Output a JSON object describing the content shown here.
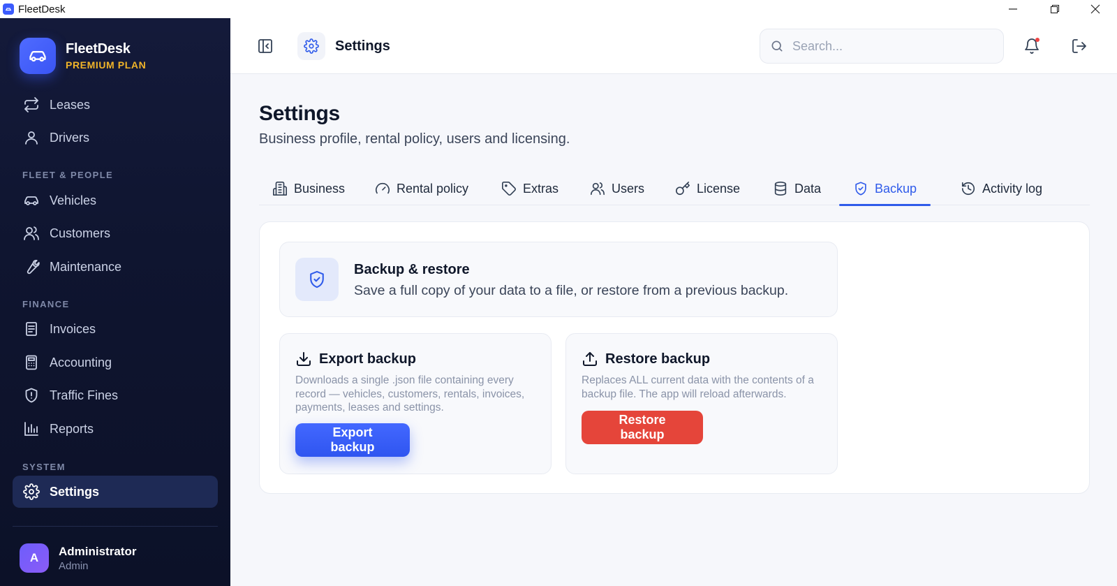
{
  "window": {
    "title": "FleetDesk"
  },
  "brand": {
    "name": "FleetDesk",
    "plan": "PREMIUM PLAN"
  },
  "sidebar": {
    "top_items": [
      {
        "label": "Leases",
        "icon": "repeat-icon"
      },
      {
        "label": "Drivers",
        "icon": "user-icon"
      }
    ],
    "sections": [
      {
        "title": "FLEET & PEOPLE",
        "items": [
          {
            "label": "Vehicles",
            "icon": "car-icon"
          },
          {
            "label": "Customers",
            "icon": "users-icon"
          },
          {
            "label": "Maintenance",
            "icon": "wrench-icon"
          }
        ]
      },
      {
        "title": "FINANCE",
        "items": [
          {
            "label": "Invoices",
            "icon": "receipt-icon"
          },
          {
            "label": "Accounting",
            "icon": "calculator-icon"
          },
          {
            "label": "Traffic Fines",
            "icon": "shield-alert-icon"
          },
          {
            "label": "Reports",
            "icon": "bar-chart-icon"
          }
        ]
      },
      {
        "title": "SYSTEM",
        "items": [
          {
            "label": "Settings",
            "icon": "gear-icon",
            "active": true
          }
        ]
      }
    ]
  },
  "user": {
    "initial": "A",
    "name": "Administrator",
    "role": "Admin"
  },
  "header": {
    "title": "Settings",
    "search_placeholder": "Search...",
    "notification_dot_color": "#ef4444"
  },
  "page": {
    "title": "Settings",
    "subtitle": "Business profile, rental policy, users and licensing."
  },
  "tabs": [
    {
      "label": "Business",
      "icon": "building-icon"
    },
    {
      "label": "Rental policy",
      "icon": "gauge-icon"
    },
    {
      "label": "Extras",
      "icon": "tag-icon"
    },
    {
      "label": "Users",
      "icon": "users-icon"
    },
    {
      "label": "License",
      "icon": "key-icon"
    },
    {
      "label": "Data",
      "icon": "database-icon"
    },
    {
      "label": "Backup",
      "icon": "shield-check-icon",
      "active": true
    },
    {
      "label": "Activity log",
      "icon": "history-icon"
    }
  ],
  "backup": {
    "title": "Backup & restore",
    "description": "Save a full copy of your data to a file, or restore from a previous backup.",
    "export": {
      "title": "Export backup",
      "description": "Downloads a single .json file containing every record — vehicles, customers, rentals, invoices, payments, leases and settings.",
      "button": "Export backup"
    },
    "restore": {
      "title": "Restore backup",
      "description": "Replaces ALL current data with the contents of a backup file. The app will reload afterwards.",
      "button": "Restore backup"
    }
  },
  "colors": {
    "accent": "#2f5bea",
    "danger": "#e5453a",
    "sidebar_bg": "#0f1530",
    "plan": "#f0b429"
  }
}
